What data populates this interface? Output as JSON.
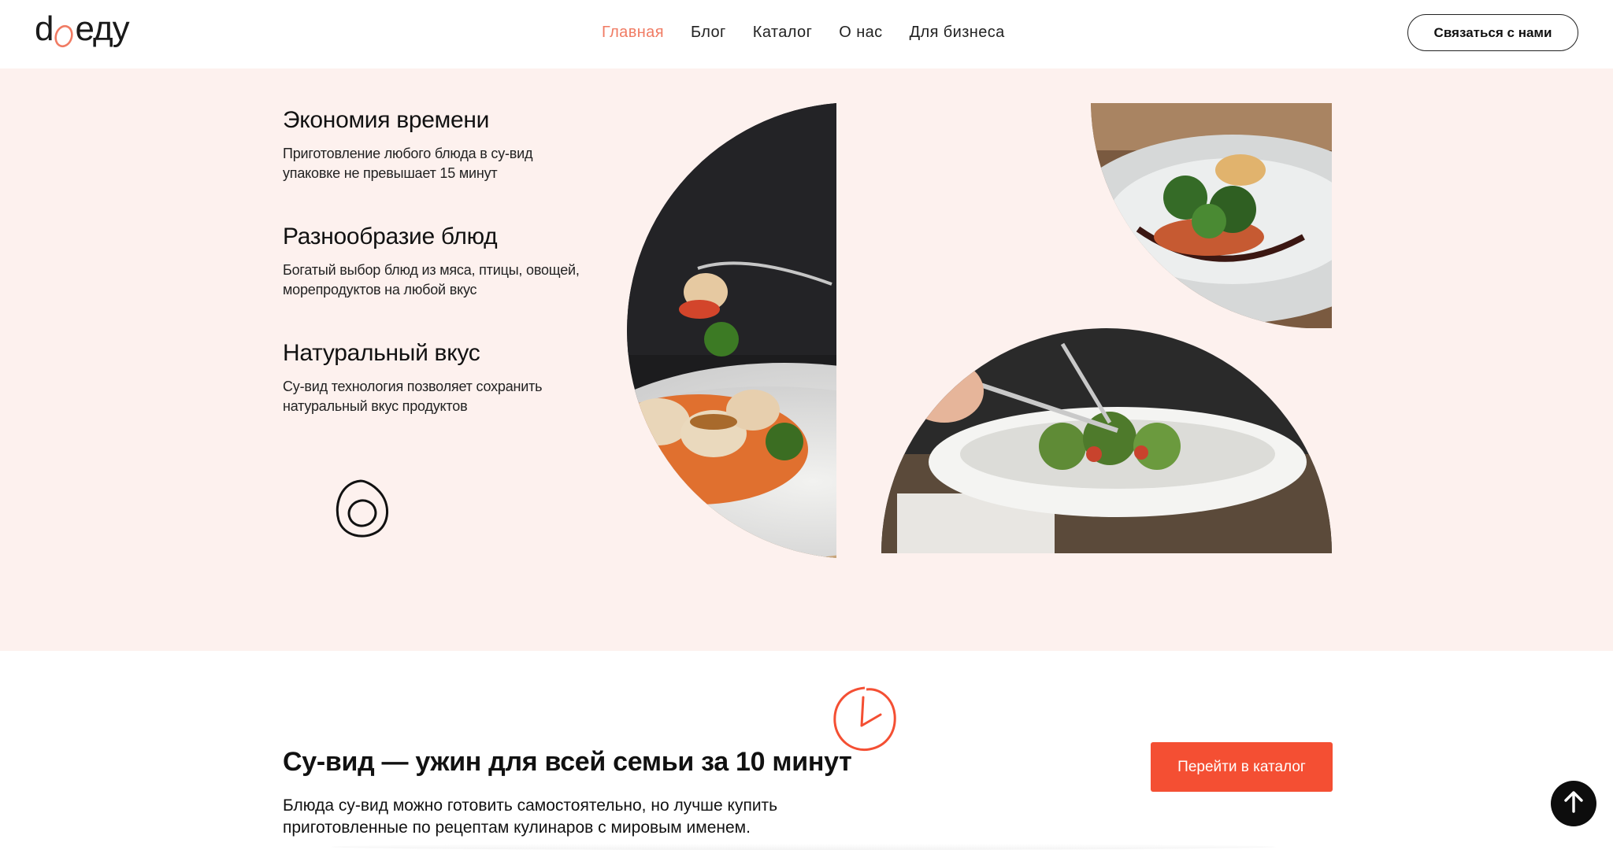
{
  "brand": {
    "logo_prefix": "d",
    "logo_suffix": "еду",
    "accent": "#f07b63",
    "cta_color": "#f44f33",
    "section_bg": "#fdf1ee"
  },
  "nav": {
    "items": [
      {
        "label": "Главная",
        "active": true
      },
      {
        "label": "Блог",
        "active": false
      },
      {
        "label": "Каталог",
        "active": false
      },
      {
        "label": "О нас",
        "active": false
      },
      {
        "label": "Для бизнеса",
        "active": false
      }
    ],
    "contact_label": "Связаться с нами"
  },
  "features": [
    {
      "title": "Экономия времени",
      "text": "Приготовление любого блюда в су-вид упаковке не превышает 15 минут"
    },
    {
      "title": "Разнообразие блюд",
      "text": "Богатый выбор блюд из мяса, птицы, овощей, морепродуктов на любой вкус"
    },
    {
      "title": "Натуральный вкус",
      "text": "Су-вид технология позволяет сохранить натуральный вкус продуктов"
    }
  ],
  "icons": {
    "egg": "egg-icon",
    "clock": "clock-icon",
    "scroll_top": "arrow-up-icon"
  },
  "cta": {
    "title": "Су-вид — ужин для всей семьи за 10 минут",
    "text": "Блюда су-вид можно готовить самостоятельно, но лучше купить приготовленные по рецептам кулинаров с мировым именем.",
    "button_label": "Перейти в каталог"
  }
}
